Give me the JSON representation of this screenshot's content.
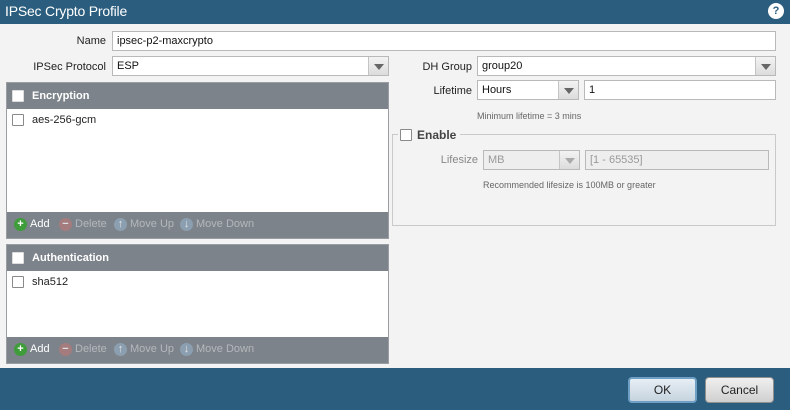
{
  "window": {
    "title": "IPSec Crypto Profile",
    "help_glyph": "?"
  },
  "form": {
    "name_label": "Name",
    "name_value": "ipsec-p2-maxcrypto",
    "protocol_label": "IPSec Protocol",
    "protocol_value": "ESP",
    "dh_label": "DH Group",
    "dh_value": "group20",
    "lifetime_label": "Lifetime",
    "lifetime_unit": "Hours",
    "lifetime_value": "1",
    "lifetime_hint": "Minimum lifetime = 3 mins",
    "enable_label": "Enable",
    "lifesize_label": "Lifesize",
    "lifesize_unit": "MB",
    "lifesize_placeholder": "[1 - 65535]",
    "lifesize_hint": "Recommended lifesize is 100MB or greater"
  },
  "encryption": {
    "header": "Encryption",
    "rows": [
      "aes-256-gcm"
    ],
    "actions": {
      "add": "Add",
      "delete": "Delete",
      "move_up": "Move Up",
      "move_down": "Move Down"
    }
  },
  "authentication": {
    "header": "Authentication",
    "rows": [
      "sha512"
    ],
    "actions": {
      "add": "Add",
      "delete": "Delete",
      "move_up": "Move Up",
      "move_down": "Move Down"
    }
  },
  "buttons": {
    "ok": "OK",
    "cancel": "Cancel"
  }
}
